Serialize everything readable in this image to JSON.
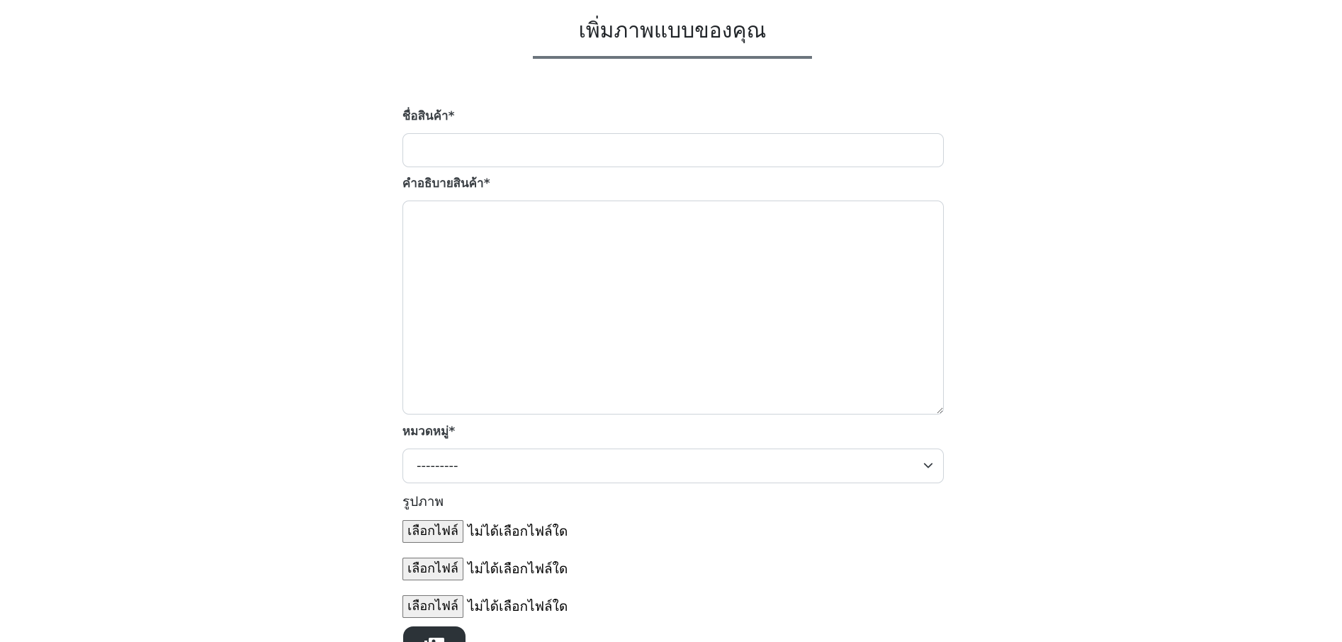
{
  "header": {
    "title": "เพิ่มภาพแบบของคุณ"
  },
  "form": {
    "product_name": {
      "label": "ชื่อสินค้า*",
      "value": ""
    },
    "product_description": {
      "label": "คำอธิบายสินค้า*",
      "value": ""
    },
    "category": {
      "label": "หมวดหมู่*",
      "selected": "---------"
    },
    "images": {
      "label": "รูปภาพ",
      "files": [
        {
          "button_label": "เลือกไฟล์",
          "status": "ไม่ได้เลือกไฟล์ใด"
        },
        {
          "button_label": "เลือกไฟล์",
          "status": "ไม่ได้เลือกไฟล์ใด"
        },
        {
          "button_label": "เลือกไฟล์",
          "status": "ไม่ได้เลือกไฟล์ใด"
        }
      ]
    },
    "submit": {
      "icon": "image-upload-icon"
    }
  },
  "colors": {
    "title_rule": "#6c757d",
    "input_border": "#ced4da",
    "submit_bg": "#2c3338"
  }
}
